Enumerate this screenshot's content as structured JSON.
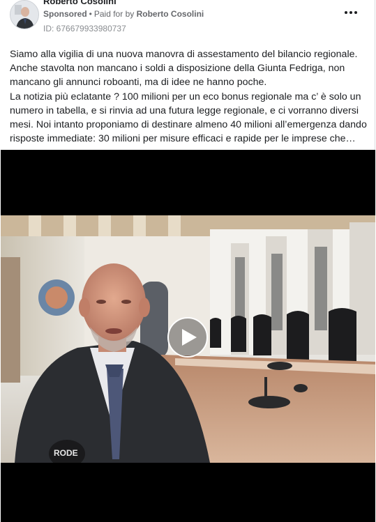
{
  "post": {
    "author_name": "Roberto Cosolini",
    "sponsored_label": "Sponsored",
    "separator": "•",
    "paid_for_prefix": "Paid for by",
    "paid_for_name": "Roberto Cosolini",
    "ad_id": "ID: 676679933980737",
    "more_icon": "more-horizontal-icon",
    "text_lines": [
      "Siamo alla vigilia di una nuova manovra di assestamento del bilancio regionale.",
      "Anche stavolta non mancano i soldi a disposizione della Giunta Fedriga, non mancano gli annunci roboanti, ma di idee ne hanno poche.",
      "La notizia più eclatante ? 100 milioni per un eco bonus regionale ma c’ è solo un numero in tabella, e si rinvia ad una futura legge regionale, e ci vorranno diversi mesi. Noi intanto proponiamo di destinare almeno 40 milioni all’emergenza dando risposte immediate: 30 milioni per misure efficaci e rapide per le imprese che…"
    ]
  },
  "video": {
    "play_icon": "play-icon",
    "microphone_brand": "RODE"
  }
}
